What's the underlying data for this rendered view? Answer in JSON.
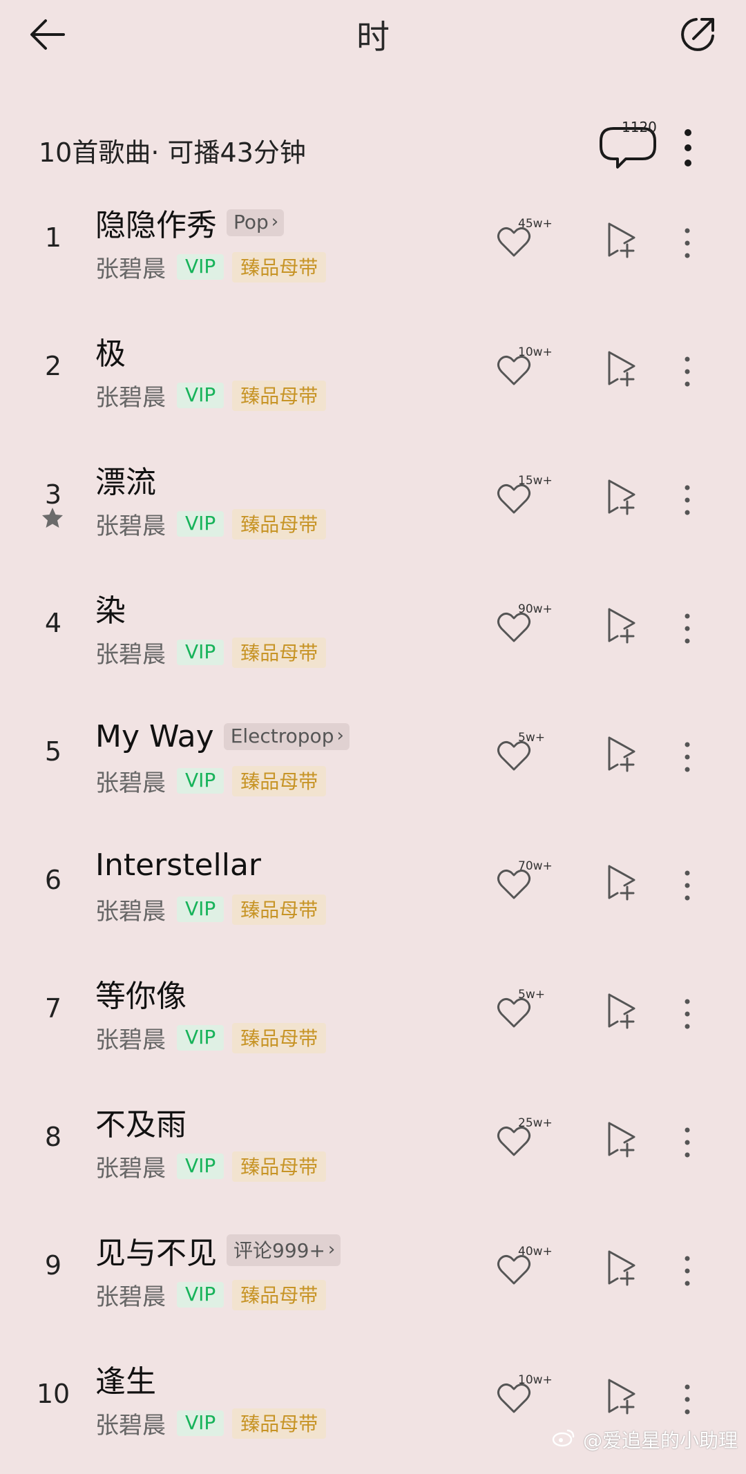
{
  "header": {
    "title": "时",
    "back_icon": "arrow-left-icon",
    "share_icon": "share-external-icon"
  },
  "summary": {
    "text": "10首歌曲· 可播43分钟",
    "comment_count": "1120",
    "comment_icon": "comment-bubble-icon",
    "more_icon": "more-vertical-icon"
  },
  "songs": [
    {
      "index": "1",
      "title": "隐隐作秀",
      "tag": "Pop",
      "artist": "张碧晨",
      "vip": "VIP",
      "quality": "臻品母带",
      "likes": "45w+"
    },
    {
      "index": "2",
      "title": "极",
      "tag": "",
      "artist": "张碧晨",
      "vip": "VIP",
      "quality": "臻品母带",
      "likes": "10w+"
    },
    {
      "index": "3",
      "title": "漂流",
      "tag": "",
      "artist": "张碧晨",
      "vip": "VIP",
      "quality": "臻品母带",
      "likes": "15w+",
      "starred": true
    },
    {
      "index": "4",
      "title": "染",
      "tag": "",
      "artist": "张碧晨",
      "vip": "VIP",
      "quality": "臻品母带",
      "likes": "90w+"
    },
    {
      "index": "5",
      "title": "My Way",
      "tag": "Electropop",
      "artist": "张碧晨",
      "vip": "VIP",
      "quality": "臻品母带",
      "likes": "5w+"
    },
    {
      "index": "6",
      "title": "Interstellar",
      "tag": "",
      "artist": "张碧晨",
      "vip": "VIP",
      "quality": "臻品母带",
      "likes": "70w+"
    },
    {
      "index": "7",
      "title": "等你像",
      "tag": "",
      "artist": "张碧晨",
      "vip": "VIP",
      "quality": "臻品母带",
      "likes": "5w+"
    },
    {
      "index": "8",
      "title": "不及雨",
      "tag": "",
      "artist": "张碧晨",
      "vip": "VIP",
      "quality": "臻品母带",
      "likes": "25w+"
    },
    {
      "index": "9",
      "title": "见与不见",
      "tag": "评论999+",
      "artist": "张碧晨",
      "vip": "VIP",
      "quality": "臻品母带",
      "likes": "40w+"
    },
    {
      "index": "10",
      "title": "逢生",
      "tag": "",
      "artist": "张碧晨",
      "vip": "VIP",
      "quality": "臻品母带",
      "likes": "10w+"
    }
  ],
  "watermark": {
    "text": "@爱追星的小助理"
  },
  "colors": {
    "background": "#f1e3e3",
    "vip": "#17b35a",
    "quality": "#c79426",
    "tag_bg": "#e0d1d1"
  }
}
